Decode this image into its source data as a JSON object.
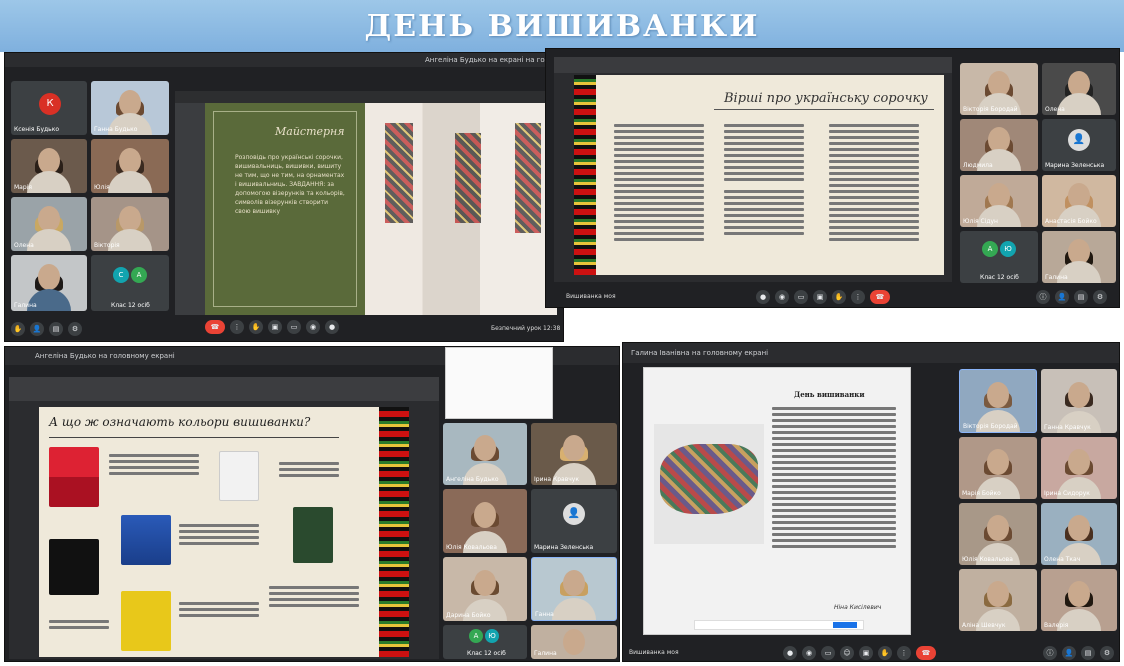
{
  "banner": {
    "title": "ДЕНЬ ВИШИВАНКИ"
  },
  "panel_tl": {
    "topbar": "Ангеліна Будько на екрані на головному екрані",
    "slide_title": "Майстерня",
    "slide_text": "Розповідь про українські сорочки, вишивальниць, вишивки, вишиту не тим, що не тим, на орнаментах і вишивальниць. ЗАВДАННЯ: за допомогою візерунків та кольорів, символів візерунків створити свою вишивку",
    "tiles": [
      {
        "name": "Ксенія Будько",
        "initial": "К"
      },
      {
        "name": "Ганна Будько"
      },
      {
        "name": "Марія"
      },
      {
        "name": "Юлія"
      },
      {
        "name": "Олена"
      },
      {
        "name": "Вікторія"
      },
      {
        "name": "Галина"
      },
      {
        "name": "Клас 12 осіб"
      }
    ],
    "group_label": "Клас 12 осіб",
    "bottom_label": "Безпечний урок",
    "time": "12:38"
  },
  "panel_tr": {
    "slide_title": "Вірші про українську сорочку",
    "tiles": [
      {
        "name": "Вікторія Бородай"
      },
      {
        "name": "Олена"
      },
      {
        "name": "Людмила"
      },
      {
        "name": "Марина Зеленська"
      },
      {
        "name": "Юлія Сідун"
      },
      {
        "name": "Анастасія Бойко"
      },
      {
        "name": "Клас 12 осіб"
      },
      {
        "name": "Галина"
      }
    ],
    "bottom_label": "Вишиванка моя"
  },
  "panel_bl": {
    "topbar": "Ангеліна Будько на головному екрані",
    "slide_title": "А що ж означають кольори вишиванки?",
    "tiles": [
      {
        "name": "Ангеліна Будько"
      },
      {
        "name": "Ірина Кравчук"
      },
      {
        "name": "Юлія Ковальова"
      },
      {
        "name": "Марина Зеленська"
      },
      {
        "name": "Дарина Бойко"
      },
      {
        "name": "Ганна"
      },
      {
        "name": "Клас 12 осіб"
      },
      {
        "name": "Галина"
      }
    ]
  },
  "panel_br": {
    "topbar": "Галина Іванівна на головному екрані",
    "slide_title": "День вишиванки",
    "poem_author": "Ніна Кисілевич",
    "tiles": [
      {
        "name": "Вікторія Бородай"
      },
      {
        "name": "Ганна Кравчук"
      },
      {
        "name": "Марія Бойко"
      },
      {
        "name": "Ірина Сидорук"
      },
      {
        "name": "Юлія Ковальова"
      },
      {
        "name": "Олена Ткач"
      },
      {
        "name": "Аліна Шевчук"
      },
      {
        "name": "Валерія"
      }
    ],
    "bottom_label": "Вишиванка моя"
  }
}
